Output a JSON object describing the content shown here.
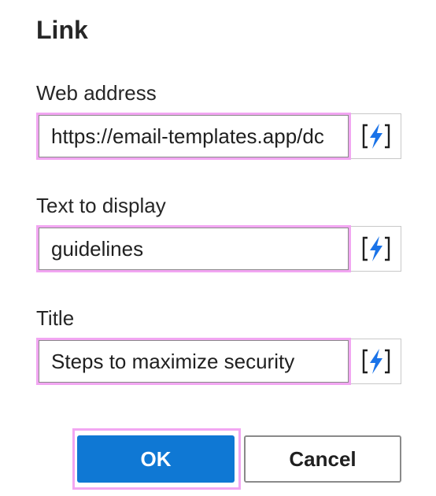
{
  "dialog": {
    "title": "Link"
  },
  "fields": {
    "web_address": {
      "label": "Web address",
      "value": "https://email-templates.app/dc"
    },
    "text_to_display": {
      "label": "Text to display",
      "value": "guidelines"
    },
    "title": {
      "label": "Title",
      "value": "Steps to maximize security"
    }
  },
  "dynamic_content_icon": "lightning-bracket-icon",
  "colors": {
    "accent": "#0f78d4",
    "highlight": "#f2a6f2",
    "icon_blue": "#1a73e8"
  },
  "buttons": {
    "ok_label": "OK",
    "cancel_label": "Cancel"
  }
}
